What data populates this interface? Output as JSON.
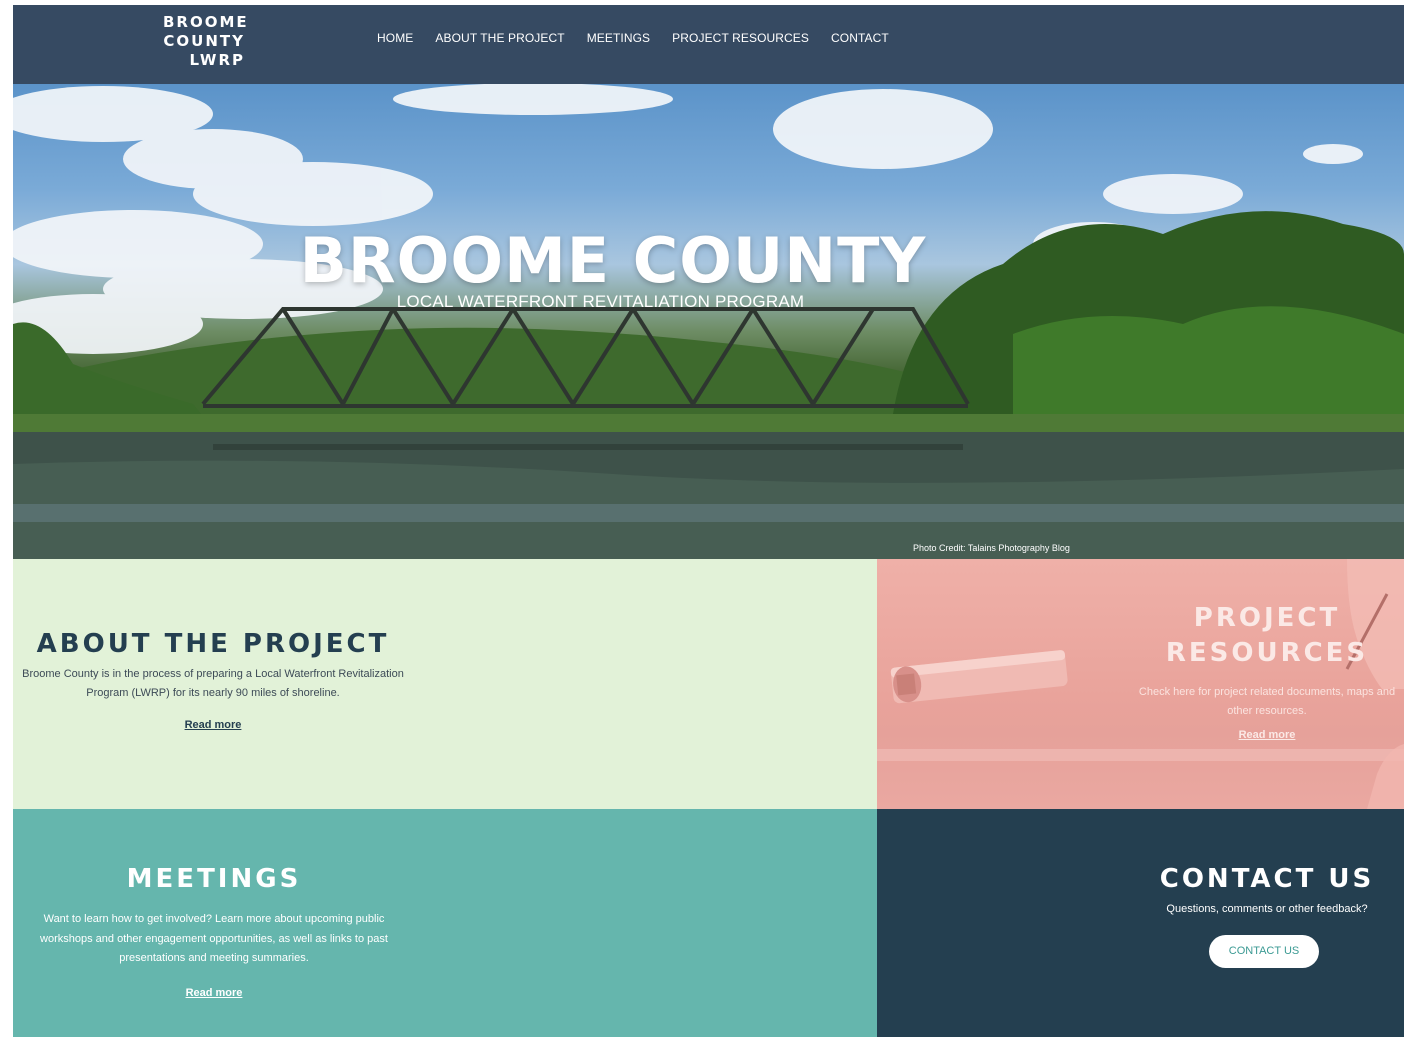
{
  "header": {
    "logo_lines": [
      "BROOME",
      "COUNTY",
      "LWRP"
    ],
    "nav": [
      "HOME",
      "ABOUT THE PROJECT",
      "MEETINGS",
      "PROJECT RESOURCES",
      "CONTACT"
    ]
  },
  "hero": {
    "title": "BROOME COUNTY",
    "subtitle": "LOCAL WATERFRONT REVITALIATION PROGRAM",
    "credit": "Photo Credit: Talains Photography Blog"
  },
  "about": {
    "title": "ABOUT THE PROJECT",
    "text": "Broome County is in the process of preparing a Local Waterfront Revitalization Program (LWRP) for its nearly 90 miles of shoreline.",
    "link": "Read more"
  },
  "resources": {
    "title": "PROJECT RESOURCES",
    "text": "Check here for project related documents, maps and other resources.",
    "link": "Read more"
  },
  "meetings": {
    "title": "MEETINGS",
    "text": "Want to learn how to get involved? Learn more about upcoming public workshops and other engagement opportunities, as well as links to past presentations and meeting summaries.",
    "link": "Read more"
  },
  "contact": {
    "title": "CONTACT US",
    "text": "Questions, comments or other feedback?",
    "button": "CONTACT US"
  },
  "colors": {
    "header": "#364a62",
    "about_bg": "#e2f2d8",
    "resources_bg": "#e9a39b",
    "meetings_bg": "#65b6ad",
    "contact_bg": "#243f50"
  }
}
